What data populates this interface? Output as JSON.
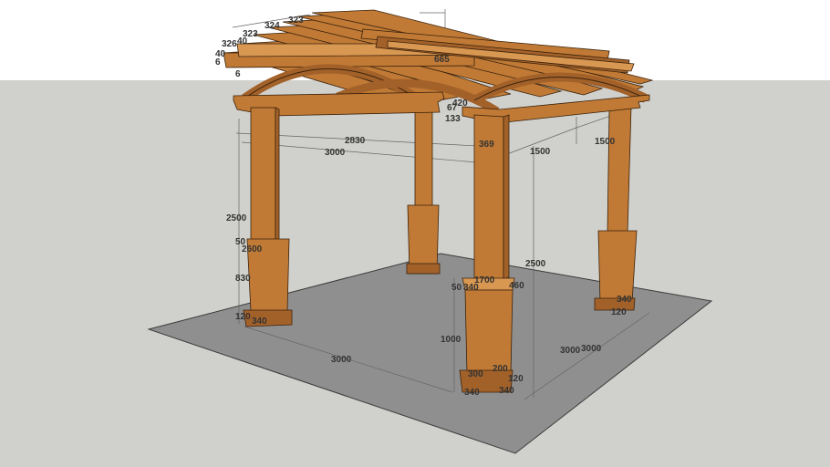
{
  "colors": {
    "sky": "#ffffff",
    "ground": "#d0d0cc",
    "slab": "#8f8f8f",
    "slab_edge": "#3a3a3a",
    "wood_front": "#c07a35",
    "wood_side": "#a3612a",
    "wood_top": "#d99852",
    "wood_edge": "#3a220c",
    "dim_line": "#666666",
    "dim_text": "#333333"
  },
  "dimensions": {
    "d323a": "323",
    "d324": "324",
    "d323b": "323",
    "d326": "326",
    "d40a": "40",
    "d40b": "40",
    "d6a": "6",
    "d6b": "6",
    "d665": "665",
    "d420": "420",
    "d67": "67",
    "d133": "133",
    "d2830": "2830",
    "d3000_top": "3000",
    "d369": "369",
    "d1500a": "1500",
    "d1500b": "1500",
    "d2500_left": "2500",
    "d50_left": "50",
    "d2600": "2600",
    "d830": "830",
    "d120_left": "120",
    "d340_left": "340",
    "d3000_front": "3000",
    "d1700": "1700",
    "d50_front": "50",
    "d340_front_top": "340",
    "d460": "460",
    "d2500_front": "2500",
    "d1000": "1000",
    "d300": "300",
    "d200": "200",
    "d120_front": "120",
    "d340_bottom_a": "340",
    "d340_bottom_b": "340",
    "d3000_right_a": "3000",
    "d3000_right_b": "3000",
    "d340_right": "340",
    "d120_right": "120"
  }
}
